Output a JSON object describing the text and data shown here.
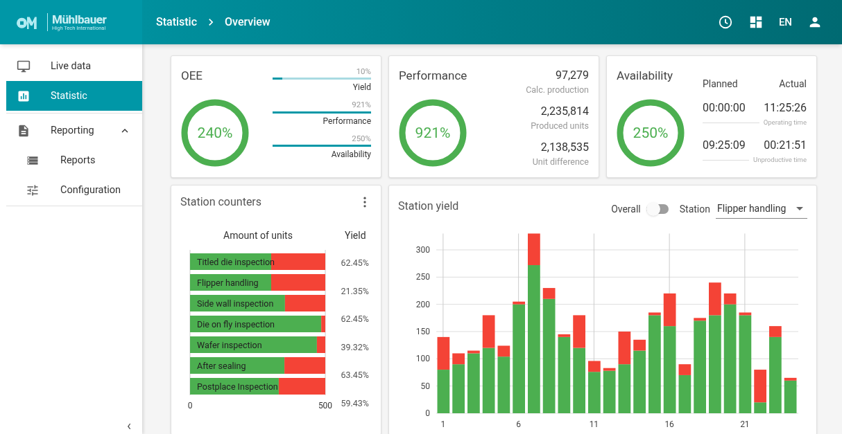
{
  "header": {
    "logo": {
      "name": "Mühlbauer",
      "tagline": "High Tech International"
    },
    "breadcrumb": [
      "Statistic",
      "Overview"
    ],
    "language": "EN"
  },
  "sidebar": {
    "items": [
      {
        "label": "Live data",
        "selected": false
      },
      {
        "label": "Statistic",
        "selected": true
      },
      {
        "label": "Reporting",
        "selected": false,
        "expanded": true,
        "children": [
          {
            "label": "Reports",
            "selected": false
          },
          {
            "label": "Configuration",
            "selected": false
          }
        ]
      }
    ],
    "collapse": "‹"
  },
  "oee": {
    "title": "OEE",
    "value": "240%",
    "bars": [
      {
        "reading": "10%",
        "label": "Yield",
        "level": 0.1
      },
      {
        "reading": "921%",
        "label": "Performance",
        "level": 1
      },
      {
        "reading": "250%",
        "label": "Availability",
        "level": 1
      }
    ]
  },
  "performance": {
    "title": "Performance",
    "value": "921%",
    "stats": [
      {
        "value": "97,279",
        "label": "Calc. production"
      },
      {
        "value": "2,235,814",
        "label": "Produced units"
      },
      {
        "value": "2,138,535",
        "label": "Unit difference"
      }
    ]
  },
  "availability": {
    "title": "Availability",
    "value": "250%",
    "columns": [
      "Planned",
      "Actual"
    ],
    "rows": [
      {
        "planned": "00:00:00",
        "actual": "11:25:26",
        "label": "Operating time"
      },
      {
        "planned": "09:25:09",
        "actual": "00:21:51",
        "label": "Unproductive time"
      }
    ]
  },
  "station_counters": {
    "title": "Station counters",
    "yield_header": "Yield",
    "yields": [
      "62.45%",
      "21.35%",
      "62.45%",
      "39.32%",
      "63.45%",
      "59.43%"
    ],
    "chart_data": {
      "type": "bar",
      "orientation": "horizontal",
      "stacked": true,
      "title": "Amount of units",
      "categories": [
        "Titled die inspection",
        "Flipper handling",
        "Side wall inspection",
        "Die on fly inspection",
        "Wafer inspection",
        "After sealing",
        "Postplace Inspection"
      ],
      "series": [
        {
          "color": "#4caf50",
          "values": [
            300,
            300,
            351,
            485,
            469,
            349,
            328
          ]
        },
        {
          "color": "#f44336",
          "values": [
            200,
            200,
            149,
            15,
            31,
            151,
            172
          ]
        }
      ],
      "xlim": [
        0,
        500
      ],
      "xticks": [
        0,
        500
      ]
    }
  },
  "station_yield": {
    "title": "Station yield",
    "overall": {
      "label": "Overall",
      "on": false
    },
    "station": {
      "label": "Station",
      "value": "Flipper handling"
    },
    "chart_data": {
      "type": "bar",
      "stacked": true,
      "x": [
        1,
        2,
        3,
        4,
        5,
        6,
        7,
        8,
        9,
        10,
        11,
        12,
        13,
        14,
        15,
        16,
        17,
        18,
        19,
        20,
        21,
        22,
        23,
        24
      ],
      "xlim": [
        0.5,
        24.5
      ],
      "grid": true,
      "series": [
        {
          "color": "#4caf50",
          "values": [
            80,
            90,
            110,
            120,
            104,
            200,
            272,
            210,
            140,
            120,
            76,
            78,
            90,
            115,
            180,
            160,
            70,
            170,
            180,
            200,
            180,
            20,
            140,
            60
          ]
        },
        {
          "color": "#f44336",
          "values": [
            60,
            20,
            5,
            60,
            20,
            5,
            58,
            20,
            5,
            60,
            20,
            5,
            60,
            20,
            5,
            60,
            20,
            5,
            60,
            20,
            5,
            60,
            20,
            5
          ]
        }
      ],
      "ylim": [
        0,
        330
      ],
      "yticks": [
        0,
        50,
        100,
        150,
        200,
        250,
        300
      ],
      "xticks": [
        1,
        6,
        11,
        16,
        21
      ]
    }
  }
}
